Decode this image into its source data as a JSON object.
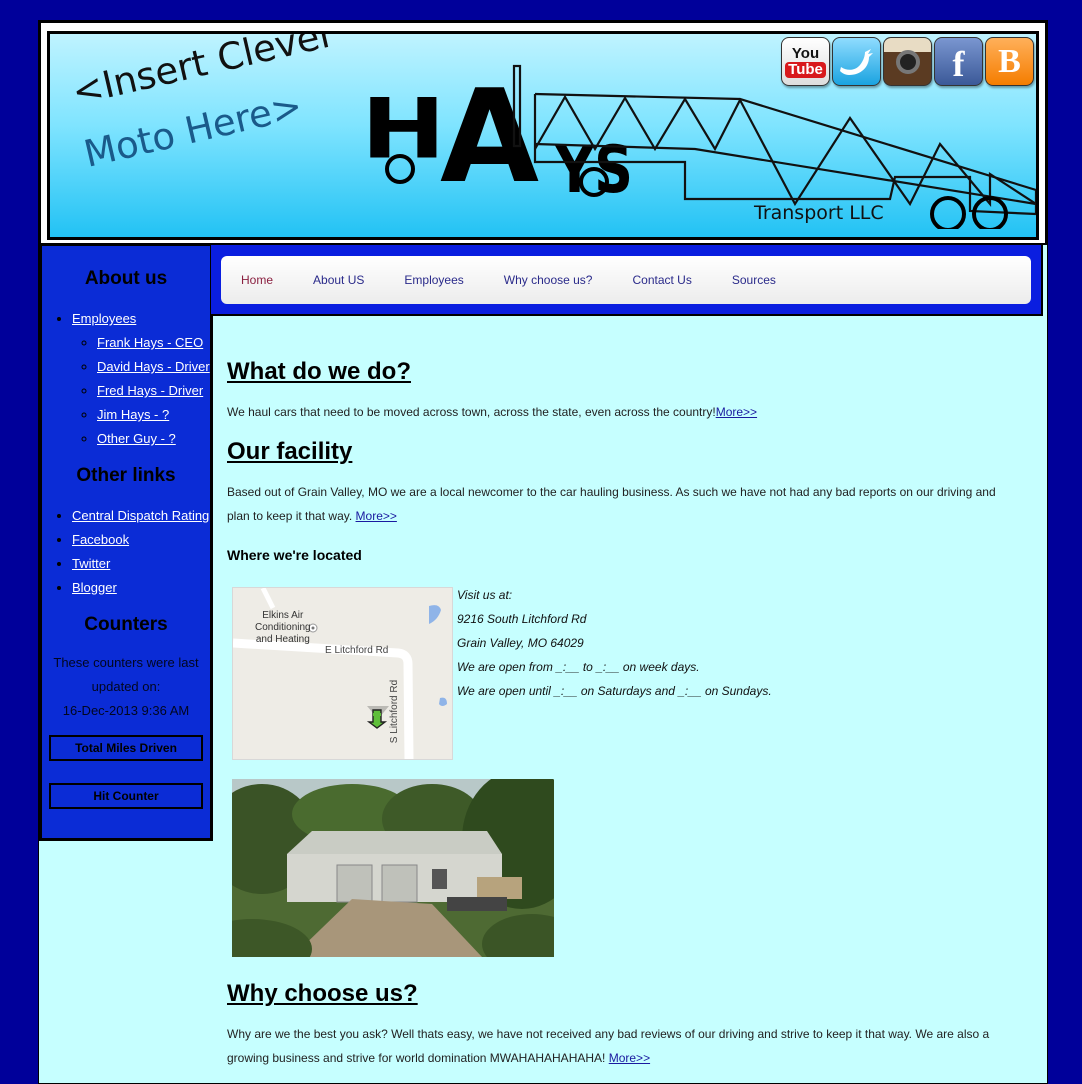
{
  "header": {
    "moto_line1": "<Insert Clever",
    "moto_line2": "Moto Here>",
    "logo_letters": [
      "H",
      "A",
      "YS"
    ],
    "logo_sub": "Transport LLC",
    "social": [
      {
        "name": "youtube-icon",
        "top": "You",
        "bottom": "Tube"
      },
      {
        "name": "twitter-icon"
      },
      {
        "name": "instagram-icon"
      },
      {
        "name": "facebook-icon",
        "glyph": "f"
      },
      {
        "name": "blogger-icon",
        "glyph": "B"
      }
    ]
  },
  "sidebar": {
    "about_heading": "About us",
    "employees_label": "Employees",
    "employees": [
      "Frank Hays - CEO",
      "David Hays - Driver",
      "Fred Hays - Driver",
      "Jim Hays - ?",
      "Other Guy - ?"
    ],
    "links_heading": "Other links",
    "links": [
      "Central Dispatch Rating",
      "Facebook",
      "Twitter",
      "Blogger"
    ],
    "counters_heading": "Counters",
    "counters_text_1": "These counters were last",
    "counters_text_2": "updated on:",
    "counters_date": "16-Dec-2013 9:36 AM",
    "counter_miles": "Total Miles Driven",
    "counter_hits": "Hit Counter"
  },
  "nav": [
    "Home",
    "About US",
    "Employees",
    "Why choose us?",
    "Contact Us",
    "Sources"
  ],
  "content": {
    "h_what": "What do we do?",
    "p_what": "We haul cars that need to be moved across town, across the state, even across the country!",
    "more": "More>>",
    "h_facility": "Our facility",
    "p_facility_1": "Based out of Grain Valley, MO we are a local newcomer to the car hauling business. As such we have not had any bad reports on our driving and",
    "p_facility_2": "plan to keep it that way.",
    "h_located": "Where we're located",
    "visit": [
      "Visit us at:",
      "9216 South Litchford Rd",
      "Grain Valley, MO 64029",
      "We are open from _:__ to _:__ on week days.",
      "We are open until _:__ on Saturdays and _:__ on Sundays."
    ],
    "map": {
      "poi": [
        "Elkins Air",
        "Conditioning",
        "and Heating"
      ],
      "road1": "E Litchford Rd",
      "road2": "S Litchford Rd"
    },
    "h_why": "Why choose us?",
    "p_why_1": "Why are we the best you ask? Well thats easy, we have not received any bad reviews of our driving and strive to keep it that way. We are also a",
    "p_why_2": "growing business and strive for world domination MWAHAHAHAHAHA!"
  }
}
